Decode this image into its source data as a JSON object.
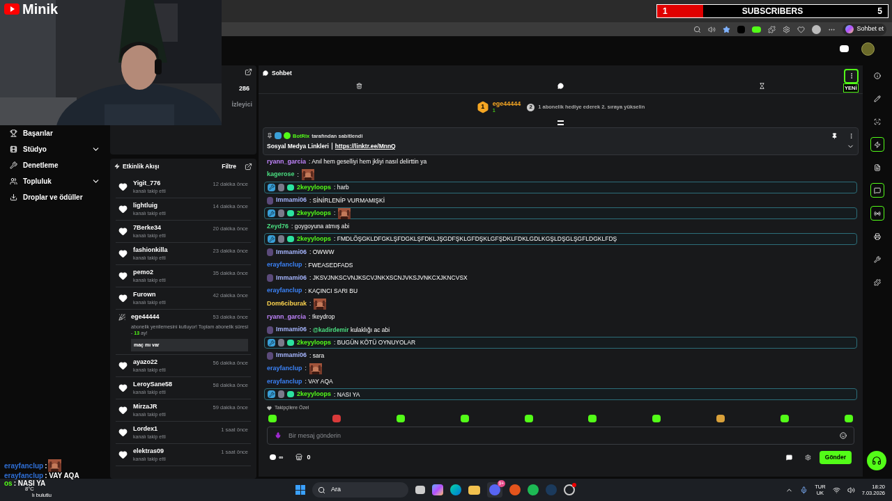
{
  "overlay": {
    "logo": "Minik",
    "subscribers": {
      "current": "1",
      "label": "SUBSCRIBERS",
      "goal": "5",
      "level": 0.2
    }
  },
  "browser": {
    "copilot_label": "Sohbet et"
  },
  "nav": [
    {
      "label": "Başarılar",
      "expandable": false
    },
    {
      "label": "Stüdyo",
      "expandable": true
    },
    {
      "label": "Denetleme",
      "expandable": false
    },
    {
      "label": "Topluluk",
      "expandable": true
    },
    {
      "label": "Droplar ve ödüller",
      "expandable": false
    }
  ],
  "stats": {
    "viewers": "286",
    "viewers_label": "İzleyici"
  },
  "activity": {
    "title": "Etkinlik Akışı",
    "filter": "Filtre",
    "items": [
      {
        "kind": "follow",
        "user": "Yigit_776",
        "action": "kanalı takip etti",
        "time": "12 dakika önce"
      },
      {
        "kind": "follow",
        "user": "lightluig",
        "action": "kanalı takip etti",
        "time": "14 dakika önce"
      },
      {
        "kind": "follow",
        "user": "7Berke34",
        "action": "kanalı takip etti",
        "time": "20 dakika önce"
      },
      {
        "kind": "follow",
        "user": "fashionkilla",
        "action": "kanalı takip etti",
        "time": "23 dakika önce"
      },
      {
        "kind": "follow",
        "user": "pemo2",
        "action": "kanalı takip etti",
        "time": "35 dakika önce"
      },
      {
        "kind": "follow",
        "user": "Furown",
        "action": "kanalı takip etti",
        "time": "42 dakika önce"
      },
      {
        "kind": "sub",
        "user": "ege44444",
        "action": "abonelik yenilemesini kutluyor! Toplam abonelik süresi - ",
        "months": "13",
        "action_end": " ay!",
        "quote": "maç mı var",
        "time": "53 dakika önce"
      },
      {
        "kind": "follow",
        "user": "ayazo22",
        "action": "kanalı takip etti",
        "time": "56 dakika önce"
      },
      {
        "kind": "follow",
        "user": "LeroySane58",
        "action": "kanalı takip etti",
        "time": "58 dakika önce"
      },
      {
        "kind": "follow",
        "user": "MirzaJR",
        "action": "kanalı takip etti",
        "time": "59 dakika önce"
      },
      {
        "kind": "follow",
        "user": "Lordex1",
        "action": "kanalı takip etti",
        "time": "1 saat önce"
      },
      {
        "kind": "follow",
        "user": "elektras09",
        "action": "kanalı takip etti",
        "time": "1 saat önce"
      }
    ]
  },
  "chat": {
    "title": "Sohbet",
    "new_label": "YENİ",
    "leader": {
      "rank": "1",
      "user": "ege44444",
      "count": "1",
      "next_rank": "2",
      "hint": "1 abonelik hediye ederek 2. sıraya yükselin"
    },
    "pinned": {
      "by": "BotRix",
      "by_suffix": "tarafından sabitlendi",
      "title": "Sosyal Medya Linkleri",
      "link": "https://linktr.ee/MnnQ"
    },
    "messages": [
      {
        "kind": "text",
        "user": "ryann_garcia",
        "color": "#c084fc",
        "boxed": false,
        "avatar": false,
        "text": ": Anıl hem geselliyi hem jkliyi nasıl delirttin ya"
      },
      {
        "kind": "emote",
        "user": "kagerose",
        "color": "#4ade80",
        "boxed": false,
        "avatar": false,
        "text": ":"
      },
      {
        "kind": "text",
        "user": "2keyyloops",
        "color": "#53fc18",
        "boxed": true,
        "avatar": false,
        "text": ": harb"
      },
      {
        "kind": "text",
        "user": "Immami06",
        "color": "#a5b4fc",
        "boxed": false,
        "avatar": true,
        "text": ": SİNİRLENİP VURMAMIŞKİ"
      },
      {
        "kind": "emote",
        "user": "2keyyloops",
        "color": "#53fc18",
        "boxed": true,
        "avatar": false,
        "text": ":"
      },
      {
        "kind": "text",
        "user": "Zeyd76",
        "color": "#4ade80",
        "boxed": false,
        "avatar": false,
        "text": ": goygoyuna atmış abi"
      },
      {
        "kind": "text",
        "user": "2keyyloops",
        "color": "#53fc18",
        "boxed": true,
        "avatar": false,
        "text": ": FMDLÖŞGKLDFGKLŞFDGKLŞFDKLJŞGDFŞKLGFDŞKLGFŞDKLFDKLGDLKGŞLDŞGLŞGFLDGKLFDŞ"
      },
      {
        "kind": "text",
        "user": "Immami06",
        "color": "#a5b4fc",
        "boxed": false,
        "avatar": true,
        "text": ": OWWW"
      },
      {
        "kind": "text",
        "user": "erayfanclup",
        "color": "#3b82f6",
        "boxed": false,
        "avatar": false,
        "text": ": FWEASEDFADS"
      },
      {
        "kind": "text",
        "user": "Immami06",
        "color": "#a5b4fc",
        "boxed": false,
        "avatar": true,
        "text": ": JKSVJNKSCVNJKSCVJNKXSCNJVKSJVNKCXJKNCVSX"
      },
      {
        "kind": "text",
        "user": "erayfanclup",
        "color": "#3b82f6",
        "boxed": false,
        "avatar": false,
        "text": ": KAÇINCI SARI BU"
      },
      {
        "kind": "emote",
        "user": "Dom6ciburak",
        "color": "#fcd34d",
        "boxed": false,
        "avatar": false,
        "text": ":"
      },
      {
        "kind": "text",
        "user": "ryann_garcia",
        "color": "#c084fc",
        "boxed": false,
        "avatar": false,
        "text": ": !keydrop"
      },
      {
        "kind": "mention",
        "user": "Immami06",
        "color": "#a5b4fc",
        "boxed": false,
        "avatar": true,
        "text": ": ",
        "mention": "@kadirdemir",
        "after": " kulaklığı ac abi"
      },
      {
        "kind": "text",
        "user": "2keyyloops",
        "color": "#53fc18",
        "boxed": true,
        "avatar": false,
        "text": ": BUGÜN KÖTÜ OYNUYOLAR"
      },
      {
        "kind": "text",
        "user": "Immami06",
        "color": "#a5b4fc",
        "boxed": false,
        "avatar": true,
        "text": ": sara"
      },
      {
        "kind": "emote",
        "user": "erayfanclup",
        "color": "#3b82f6",
        "boxed": false,
        "avatar": false,
        "text": ":"
      },
      {
        "kind": "text",
        "user": "erayfanclup",
        "color": "#3b82f6",
        "boxed": false,
        "avatar": false,
        "text": ": VAY AQA"
      },
      {
        "kind": "text",
        "user": "2keyyloops",
        "color": "#53fc18",
        "boxed": true,
        "avatar": false,
        "text": ": NASI YA"
      }
    ],
    "emote_section": "Takipçilere Özel",
    "input": {
      "placeholder": "Bir mesaj gönderin"
    },
    "footer": {
      "points": "∞",
      "shop_count": "0",
      "send": "Gönder"
    }
  },
  "overlay_chat": [
    {
      "kind": "emote",
      "user": "erayfanclup",
      "sep": ":"
    },
    {
      "kind": "text",
      "user": "erayfanclup",
      "text": ": VAY AQA"
    },
    {
      "kind": "text",
      "user": "os",
      "text": ": NASI YA"
    }
  ],
  "taskbar": {
    "temperature": "8°C",
    "weather": "lı bulutlu",
    "search": "Ara",
    "discord_badge": "9+",
    "lang": "TUR",
    "layout": "UK",
    "time": "18:20",
    "date": "7.03.2026"
  }
}
